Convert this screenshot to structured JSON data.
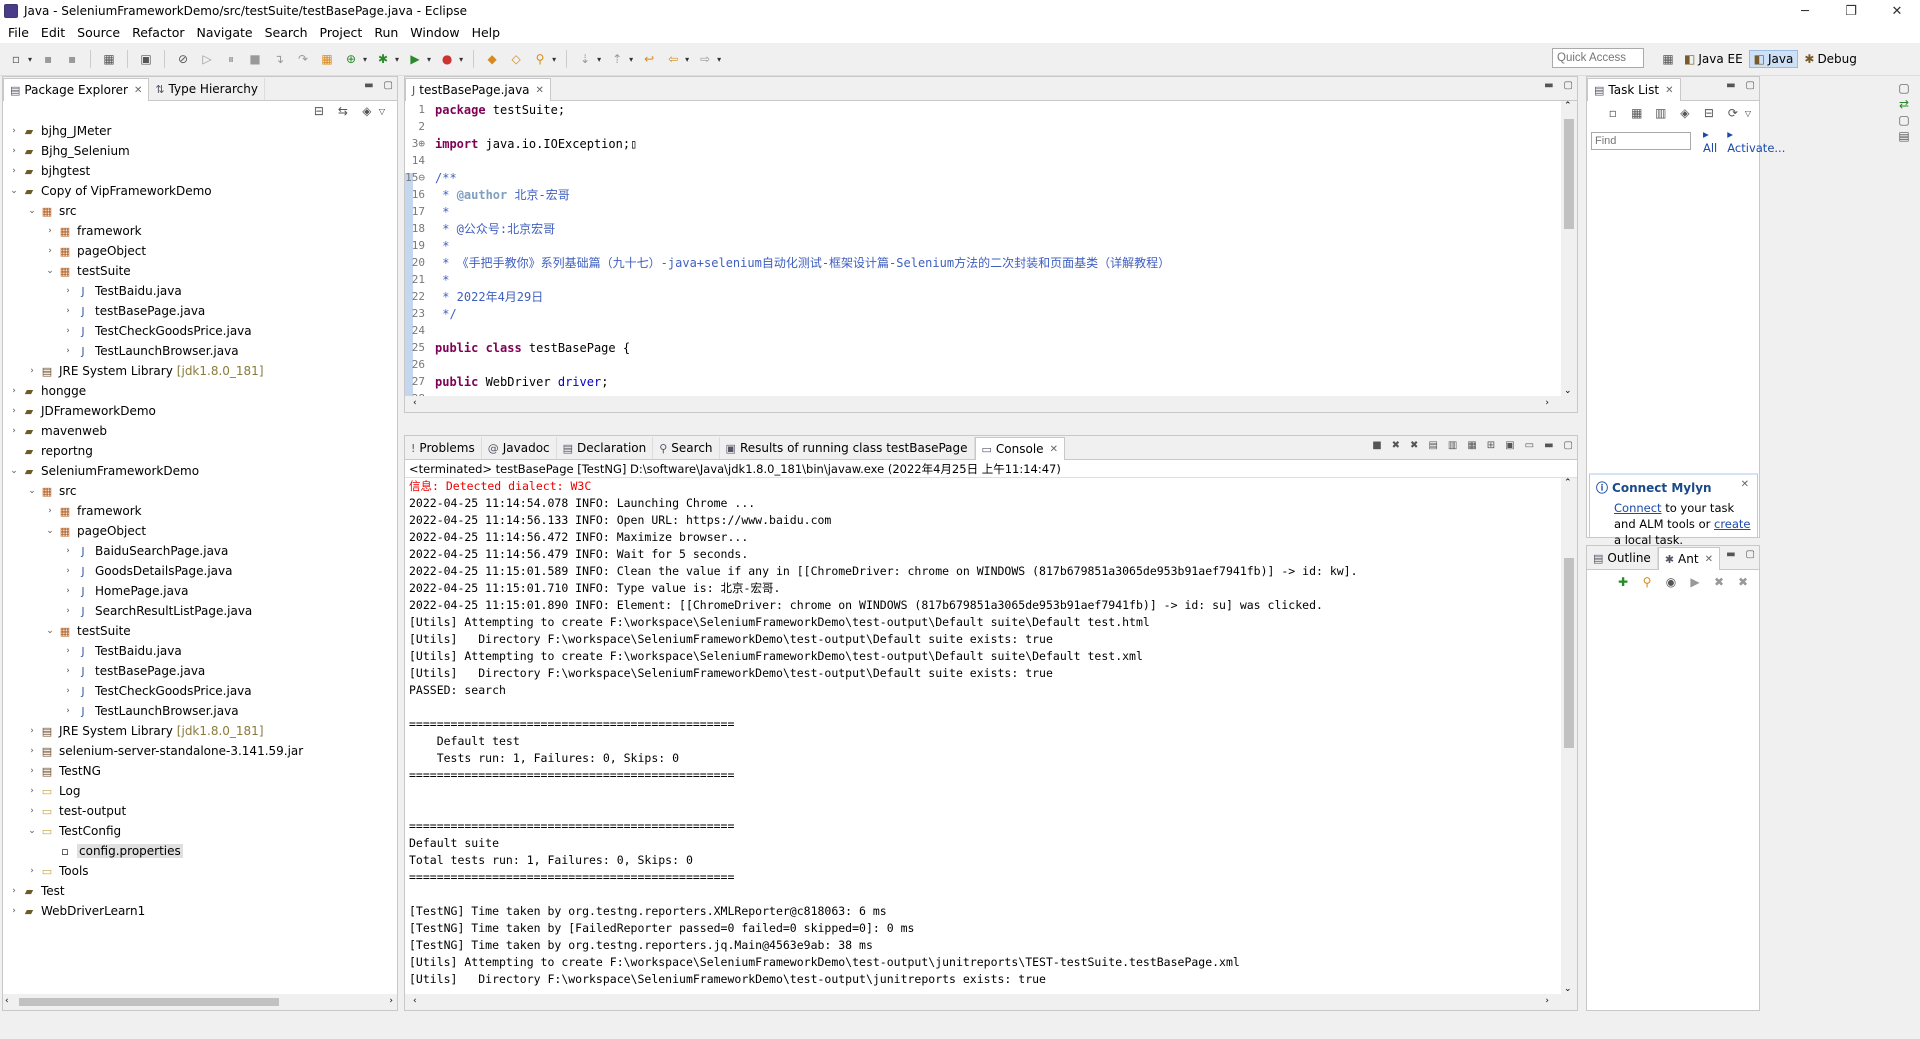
{
  "window": {
    "title": "Java - SeleniumFrameworkDemo/src/testSuite/testBasePage.java - Eclipse",
    "min": "─",
    "max": "❐",
    "close": "✕"
  },
  "menu": [
    "File",
    "Edit",
    "Source",
    "Refactor",
    "Navigate",
    "Search",
    "Project",
    "Run",
    "Window",
    "Help"
  ],
  "quick_access": {
    "placeholder": "Quick Access"
  },
  "perspectives": [
    {
      "label": "Java EE",
      "active": false
    },
    {
      "label": "Java",
      "active": true
    },
    {
      "label": "Debug",
      "active": false
    }
  ],
  "explorer": {
    "tabs": [
      {
        "label": "Package Explorer"
      },
      {
        "label": "Type Hierarchy"
      }
    ],
    "tree": [
      {
        "depth": 0,
        "twisty": "›",
        "icon": "project",
        "label": "bjhg_JMeter"
      },
      {
        "depth": 0,
        "twisty": "›",
        "icon": "project",
        "label": "Bjhg_Selenium"
      },
      {
        "depth": 0,
        "twisty": "›",
        "icon": "project",
        "label": "bjhgtest"
      },
      {
        "depth": 0,
        "twisty": "⌄",
        "icon": "project",
        "label": "Copy of VipFrameworkDemo"
      },
      {
        "depth": 1,
        "twisty": "⌄",
        "icon": "srcfolder",
        "label": "src"
      },
      {
        "depth": 2,
        "twisty": "›",
        "icon": "package",
        "label": "framework"
      },
      {
        "depth": 2,
        "twisty": "›",
        "icon": "package",
        "label": "pageObject"
      },
      {
        "depth": 2,
        "twisty": "⌄",
        "icon": "package",
        "label": "testSuite"
      },
      {
        "depth": 3,
        "twisty": "›",
        "icon": "java",
        "label": "TestBaidu.java"
      },
      {
        "depth": 3,
        "twisty": "›",
        "icon": "java",
        "label": "testBasePage.java"
      },
      {
        "depth": 3,
        "twisty": "›",
        "icon": "java",
        "label": "TestCheckGoodsPrice.java"
      },
      {
        "depth": 3,
        "twisty": "›",
        "icon": "java",
        "label": "TestLaunchBrowser.java"
      },
      {
        "depth": 1,
        "twisty": "›",
        "icon": "jre",
        "label": "JRE System Library",
        "extra": "[jdk1.8.0_181]"
      },
      {
        "depth": 0,
        "twisty": "›",
        "icon": "project",
        "label": "hongge"
      },
      {
        "depth": 0,
        "twisty": "›",
        "icon": "project",
        "label": "JDFrameworkDemo"
      },
      {
        "depth": 0,
        "twisty": "›",
        "icon": "project",
        "label": "mavenweb"
      },
      {
        "depth": 0,
        "twisty": "",
        "icon": "project",
        "label": "reportng"
      },
      {
        "depth": 0,
        "twisty": "⌄",
        "icon": "project",
        "label": "SeleniumFrameworkDemo"
      },
      {
        "depth": 1,
        "twisty": "⌄",
        "icon": "srcfolder",
        "label": "src"
      },
      {
        "depth": 2,
        "twisty": "›",
        "icon": "package",
        "label": "framework"
      },
      {
        "depth": 2,
        "twisty": "⌄",
        "icon": "package",
        "label": "pageObject"
      },
      {
        "depth": 3,
        "twisty": "›",
        "icon": "java",
        "label": "BaiduSearchPage.java"
      },
      {
        "depth": 3,
        "twisty": "›",
        "icon": "java",
        "label": "GoodsDetailsPage.java"
      },
      {
        "depth": 3,
        "twisty": "›",
        "icon": "java",
        "label": "HomePage.java"
      },
      {
        "depth": 3,
        "twisty": "›",
        "icon": "java",
        "label": "SearchResultListPage.java"
      },
      {
        "depth": 2,
        "twisty": "⌄",
        "icon": "package",
        "label": "testSuite"
      },
      {
        "depth": 3,
        "twisty": "›",
        "icon": "java",
        "label": "TestBaidu.java"
      },
      {
        "depth": 3,
        "twisty": "›",
        "icon": "java",
        "label": "testBasePage.java"
      },
      {
        "depth": 3,
        "twisty": "›",
        "icon": "java",
        "label": "TestCheckGoodsPrice.java"
      },
      {
        "depth": 3,
        "twisty": "›",
        "icon": "java",
        "label": "TestLaunchBrowser.java"
      },
      {
        "depth": 1,
        "twisty": "›",
        "icon": "jre",
        "label": "JRE System Library",
        "extra": "[jdk1.8.0_181]"
      },
      {
        "depth": 1,
        "twisty": "›",
        "icon": "jar",
        "label": "selenium-server-standalone-3.141.59.jar"
      },
      {
        "depth": 1,
        "twisty": "›",
        "icon": "lib",
        "label": "TestNG"
      },
      {
        "depth": 1,
        "twisty": "›",
        "icon": "folder",
        "label": "Log"
      },
      {
        "depth": 1,
        "twisty": "›",
        "icon": "folder",
        "label": "test-output"
      },
      {
        "depth": 1,
        "twisty": "⌄",
        "icon": "folder",
        "label": "TestConfig"
      },
      {
        "depth": 2,
        "twisty": "",
        "icon": "file",
        "label": "config.properties",
        "selected": true
      },
      {
        "depth": 1,
        "twisty": "›",
        "icon": "folder",
        "label": "Tools"
      },
      {
        "depth": 0,
        "twisty": "›",
        "icon": "project",
        "label": "Test"
      },
      {
        "depth": 0,
        "twisty": "›",
        "icon": "project",
        "label": "WebDriverLearn1"
      }
    ]
  },
  "editor": {
    "tab": "testBasePage.java",
    "lines": [
      {
        "n": "1",
        "parts": [
          [
            "kw",
            "package"
          ],
          [
            "",
            " testSuite;"
          ]
        ]
      },
      {
        "n": "2",
        "parts": []
      },
      {
        "n": "3⊕",
        "parts": [
          [
            "kw",
            "import"
          ],
          [
            "",
            " java.io.IOException;▯"
          ]
        ]
      },
      {
        "n": "14",
        "parts": []
      },
      {
        "n": "15⊖",
        "parts": [
          [
            "cm",
            "/**"
          ]
        ]
      },
      {
        "n": "16",
        "parts": [
          [
            "cm",
            " * "
          ],
          [
            "cm-tag",
            "@author"
          ],
          [
            "cm",
            " 北京-宏哥"
          ]
        ]
      },
      {
        "n": "17",
        "parts": [
          [
            "cm",
            " *"
          ]
        ]
      },
      {
        "n": "18",
        "parts": [
          [
            "cm",
            " * @公众号:北京宏哥"
          ]
        ]
      },
      {
        "n": "19",
        "parts": [
          [
            "cm",
            " *"
          ]
        ]
      },
      {
        "n": "20",
        "parts": [
          [
            "cm",
            " * 《手把手教你》系列基础篇（九十七）-java+selenium自动化测试-框架设计篇-Selenium方法的二次封装和页面基类（详解教程）"
          ]
        ]
      },
      {
        "n": "21",
        "parts": [
          [
            "cm",
            " *"
          ]
        ]
      },
      {
        "n": "22",
        "parts": [
          [
            "cm",
            " * 2022年4月29日"
          ]
        ]
      },
      {
        "n": "23",
        "parts": [
          [
            "cm",
            " */"
          ]
        ]
      },
      {
        "n": "24",
        "parts": []
      },
      {
        "n": "25",
        "parts": [
          [
            "kw",
            "public class"
          ],
          [
            "",
            " testBasePage {"
          ]
        ]
      },
      {
        "n": "26",
        "parts": []
      },
      {
        "n": "27",
        "parts": [
          [
            "kw",
            "public"
          ],
          [
            "",
            " WebDriver "
          ],
          [
            "fld",
            "driver"
          ],
          [
            "",
            ";"
          ]
        ]
      },
      {
        "n": "28",
        "parts": []
      }
    ]
  },
  "bottom": {
    "tabs": [
      {
        "label": "Problems",
        "icon": "!"
      },
      {
        "label": "Javadoc",
        "icon": "@"
      },
      {
        "label": "Declaration",
        "icon": "▤"
      },
      {
        "label": "Search",
        "icon": "⚲"
      },
      {
        "label": "Results of running class testBasePage",
        "icon": "▣"
      },
      {
        "label": "Console",
        "icon": "▭",
        "active": true
      }
    ],
    "console_header": "<terminated> testBasePage [TestNG] D:\\software\\Java\\jdk1.8.0_181\\bin\\javaw.exe (2022年4月25日 上午11:14:47)",
    "console_lines": [
      {
        "t": "信息: Detected dialect: W3C",
        "err": true
      },
      {
        "t": "2022-04-25 11:14:54.078 INFO: Launching Chrome ..."
      },
      {
        "t": "2022-04-25 11:14:56.133 INFO: Open URL: https://www.baidu.com"
      },
      {
        "t": "2022-04-25 11:14:56.472 INFO: Maximize browser..."
      },
      {
        "t": "2022-04-25 11:14:56.479 INFO: Wait for 5 seconds."
      },
      {
        "t": "2022-04-25 11:15:01.589 INFO: Clean the value if any in [[ChromeDriver: chrome on WINDOWS (817b679851a3065de953b91aef7941fb)] -> id: kw]."
      },
      {
        "t": "2022-04-25 11:15:01.710 INFO: Type value is: 北京-宏哥."
      },
      {
        "t": "2022-04-25 11:15:01.890 INFO: Element: [[ChromeDriver: chrome on WINDOWS (817b679851a3065de953b91aef7941fb)] -> id: su] was clicked."
      },
      {
        "t": "[Utils] Attempting to create F:\\workspace\\SeleniumFrameworkDemo\\test-output\\Default suite\\Default test.html"
      },
      {
        "t": "[Utils]   Directory F:\\workspace\\SeleniumFrameworkDemo\\test-output\\Default suite exists: true"
      },
      {
        "t": "[Utils] Attempting to create F:\\workspace\\SeleniumFrameworkDemo\\test-output\\Default suite\\Default test.xml"
      },
      {
        "t": "[Utils]   Directory F:\\workspace\\SeleniumFrameworkDemo\\test-output\\Default suite exists: true"
      },
      {
        "t": "PASSED: search"
      },
      {
        "t": ""
      },
      {
        "t": "==============================================="
      },
      {
        "t": "    Default test"
      },
      {
        "t": "    Tests run: 1, Failures: 0, Skips: 0"
      },
      {
        "t": "==============================================="
      },
      {
        "t": ""
      },
      {
        "t": ""
      },
      {
        "t": "==============================================="
      },
      {
        "t": "Default suite"
      },
      {
        "t": "Total tests run: 1, Failures: 0, Skips: 0"
      },
      {
        "t": "==============================================="
      },
      {
        "t": ""
      },
      {
        "t": "[TestNG] Time taken by org.testng.reporters.XMLReporter@c818063: 6 ms"
      },
      {
        "t": "[TestNG] Time taken by [FailedReporter passed=0 failed=0 skipped=0]: 0 ms"
      },
      {
        "t": "[TestNG] Time taken by org.testng.reporters.jq.Main@4563e9ab: 38 ms"
      },
      {
        "t": "[Utils] Attempting to create F:\\workspace\\SeleniumFrameworkDemo\\test-output\\junitreports\\TEST-testSuite.testBasePage.xml"
      },
      {
        "t": "[Utils]   Directory F:\\workspace\\SeleniumFrameworkDemo\\test-output\\junitreports exists: true"
      }
    ]
  },
  "tasklist": {
    "tab": "Task List",
    "find_placeholder": "Find",
    "all_label": "All",
    "activate_label": "Activate..."
  },
  "mylyn": {
    "title": "Connect Mylyn",
    "connect": "Connect",
    "mid": " to your task and ALM tools or ",
    "create": "create",
    "end": "a local task."
  },
  "outline": {
    "tabs": [
      "Outline",
      "Ant"
    ]
  }
}
